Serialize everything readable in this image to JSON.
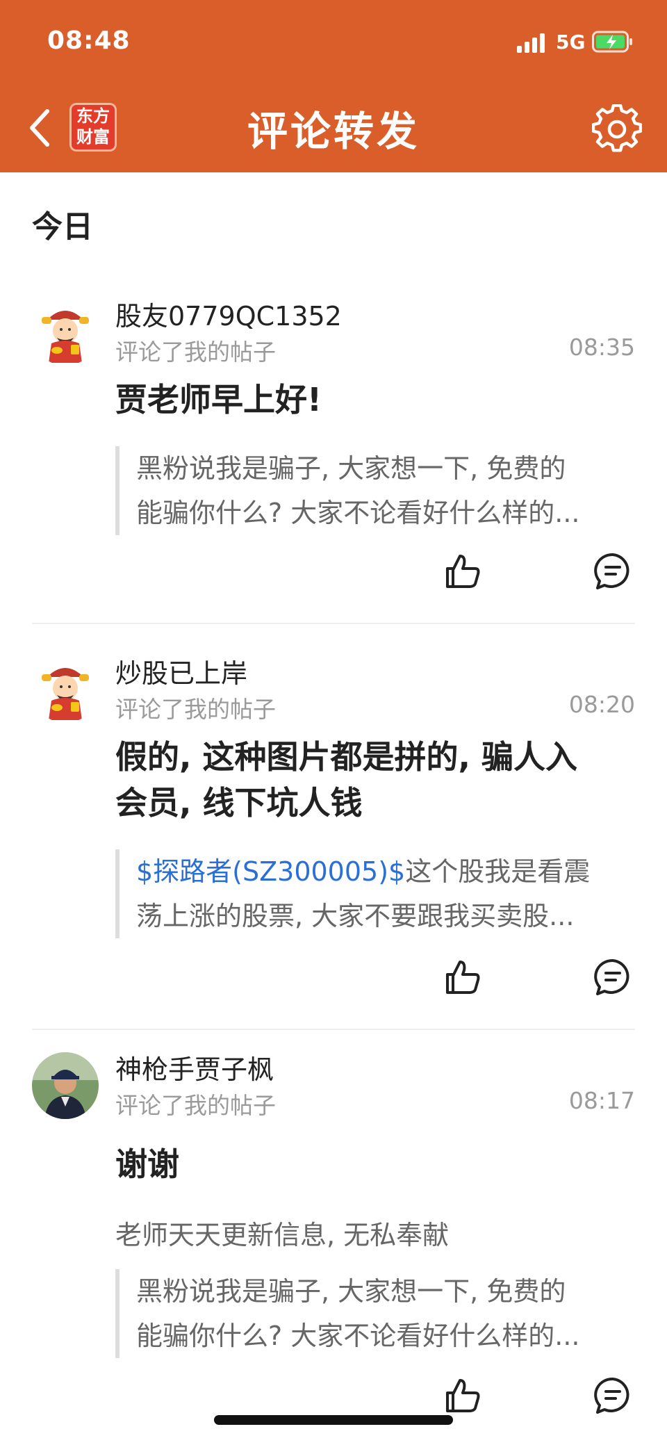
{
  "status_bar": {
    "time": "08:48",
    "network": "5G"
  },
  "nav": {
    "logo_line1": "东方",
    "logo_line2": "财富",
    "title": "评论转发"
  },
  "section": {
    "title": "今日"
  },
  "items": [
    {
      "username": "股友0779QC1352",
      "action": "评论了我的帖子",
      "time": "08:35",
      "comment_line1": "贾老师早上好!",
      "quote_line1": "黑粉说我是骗子, 大家想一下, 免费的",
      "quote_line2": "能骗你什么? 大家不论看好什么样的..."
    },
    {
      "username": "炒股已上岸",
      "action": "评论了我的帖子",
      "time": "08:20",
      "comment_line1": "假的, 这种图片都是拼的, 骗人入",
      "comment_line2": "会员, 线下坑人钱",
      "quote_link": "$探路者(SZ300005)$",
      "quote_line1_rest": "这个股我是看震",
      "quote_line2": "荡上涨的股票, 大家不要跟我买卖股..."
    },
    {
      "username": "神枪手贾子枫",
      "action": "评论了我的帖子",
      "time": "08:17",
      "comment_line1": "谢谢",
      "reply_text": "老师天天更新信息, 无私奉献",
      "quote_line1": "黑粉说我是骗子, 大家想一下, 免费的",
      "quote_line2": "能骗你什么? 大家不论看好什么样的..."
    }
  ],
  "colors": {
    "header": "#d95e2a",
    "link": "#2a6fd6",
    "muted": "#9a9a9a"
  },
  "icons": [
    "back-chevron-icon",
    "settings-gear-icon",
    "thumbs-up-icon",
    "comment-bubble-icon",
    "signal-icon",
    "battery-charging-icon"
  ]
}
